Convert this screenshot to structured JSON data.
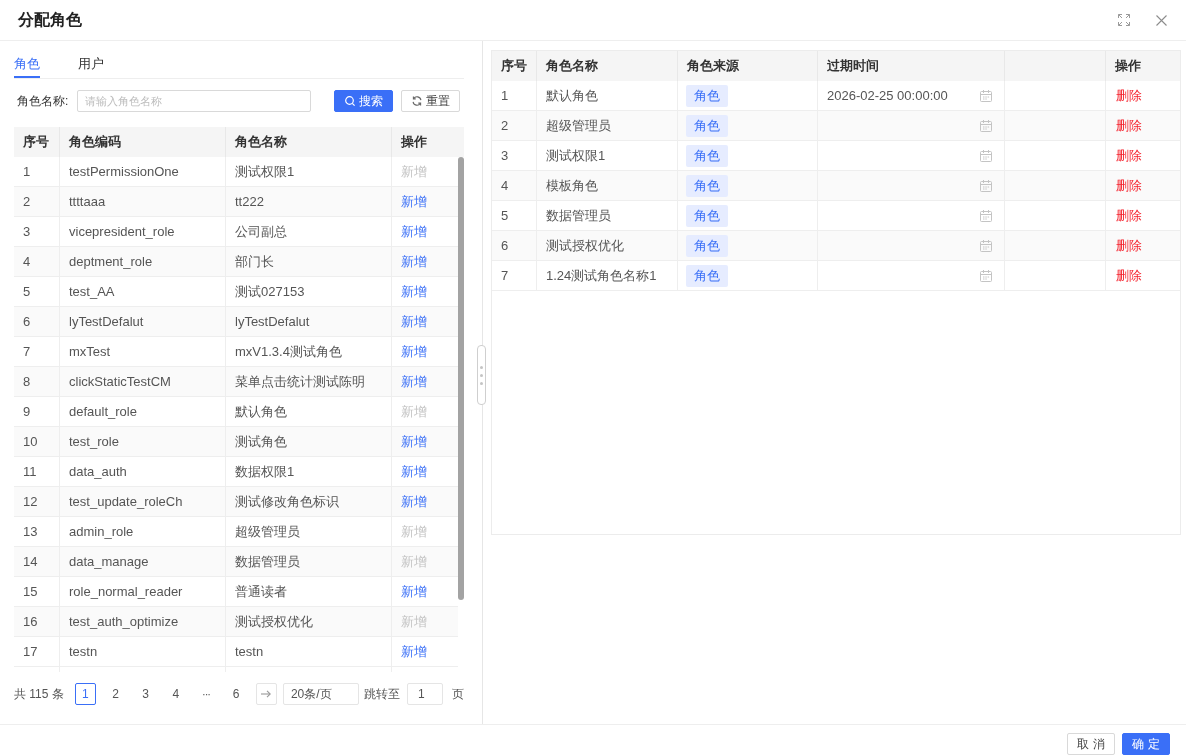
{
  "dialog": {
    "title": "分配角色"
  },
  "tabs": [
    {
      "label": "角色",
      "selected": true
    },
    {
      "label": "用户",
      "selected": false
    }
  ],
  "search": {
    "label": "角色名称:",
    "placeholder": "请输入角色名称",
    "buttons": [
      {
        "label": "搜索",
        "kind": "search"
      },
      {
        "label": "重置",
        "kind": "reset"
      }
    ]
  },
  "role_table": {
    "columns": [
      "序号",
      "角色编码",
      "角色名称",
      "操作"
    ],
    "rows": [
      {
        "index": "1",
        "code": "testPermissionOne",
        "name": "测试权限1",
        "action": "新增",
        "disabled": true
      },
      {
        "index": "2",
        "code": "ttttaaa",
        "name": "tt222",
        "action": "新增",
        "disabled": false
      },
      {
        "index": "3",
        "code": "vicepresident_role",
        "name": "公司副总",
        "action": "新增",
        "disabled": false
      },
      {
        "index": "4",
        "code": "deptment_role",
        "name": "部门长",
        "action": "新增",
        "disabled": false
      },
      {
        "index": "5",
        "code": "test_AA",
        "name": "测试027153",
        "action": "新增",
        "disabled": false
      },
      {
        "index": "6",
        "code": "lyTestDefalut",
        "name": "lyTestDefalut",
        "action": "新增",
        "disabled": false
      },
      {
        "index": "7",
        "code": "mxTest",
        "name": "mxV1.3.4测试角色",
        "action": "新增",
        "disabled": false
      },
      {
        "index": "8",
        "code": "clickStaticTestCM",
        "name": "菜单点击统计测试陈明",
        "action": "新增",
        "disabled": false
      },
      {
        "index": "9",
        "code": "default_role",
        "name": "默认角色",
        "action": "新增",
        "disabled": true
      },
      {
        "index": "10",
        "code": "test_role",
        "name": "测试角色",
        "action": "新增",
        "disabled": false
      },
      {
        "index": "11",
        "code": "data_auth",
        "name": "数据权限1",
        "action": "新增",
        "disabled": false
      },
      {
        "index": "12",
        "code": "test_update_roleCh",
        "name": "测试修改角色标识",
        "action": "新增",
        "disabled": false
      },
      {
        "index": "13",
        "code": "admin_role",
        "name": "超级管理员",
        "action": "新增",
        "disabled": true
      },
      {
        "index": "14",
        "code": "data_manage",
        "name": "数据管理员",
        "action": "新增",
        "disabled": true
      },
      {
        "index": "15",
        "code": "role_normal_reader",
        "name": "普通读者",
        "action": "新增",
        "disabled": false
      },
      {
        "index": "16",
        "code": "test_auth_optimize",
        "name": "测试授权优化",
        "action": "新增",
        "disabled": true
      },
      {
        "index": "17",
        "code": "testn",
        "name": "testn",
        "action": "新增",
        "disabled": false
      }
    ]
  },
  "pagination": {
    "total": "共 115 条",
    "pages": [
      {
        "label": "1",
        "kind": "page",
        "selected": true
      },
      {
        "label": "2",
        "kind": "page",
        "selected": false
      },
      {
        "label": "3",
        "kind": "page",
        "selected": false
      },
      {
        "label": "4",
        "kind": "page",
        "selected": false
      },
      {
        "label": "···",
        "kind": "ellipsis",
        "selected": false
      },
      {
        "label": "6",
        "kind": "page",
        "selected": false
      }
    ],
    "page_size": "20条/页",
    "jump_label": "跳转至",
    "jump_value": "1",
    "jump_suffix": "页"
  },
  "assigned_table": {
    "columns": [
      "序号",
      "角色名称",
      "角色来源",
      "过期时间",
      "操作"
    ],
    "rows": [
      {
        "index": "1",
        "name": "默认角色",
        "source": "角色",
        "expires": "2026-02-25 00:00:00",
        "action": "删除"
      },
      {
        "index": "2",
        "name": "超级管理员",
        "source": "角色",
        "action": "删除"
      },
      {
        "index": "3",
        "name": "测试权限1",
        "source": "角色",
        "action": "删除"
      },
      {
        "index": "4",
        "name": "模板角色",
        "source": "角色",
        "action": "删除"
      },
      {
        "index": "5",
        "name": "数据管理员",
        "source": "角色",
        "action": "删除"
      },
      {
        "index": "6",
        "name": "测试授权优化",
        "source": "角色",
        "action": "删除"
      },
      {
        "index": "7",
        "name": "1.24测试角色名称1",
        "source": "角色",
        "action": "删除"
      }
    ]
  },
  "footer": {
    "buttons": [
      {
        "label": "取 消",
        "kind": "default"
      },
      {
        "label": "确 定",
        "kind": "primary"
      }
    ]
  }
}
